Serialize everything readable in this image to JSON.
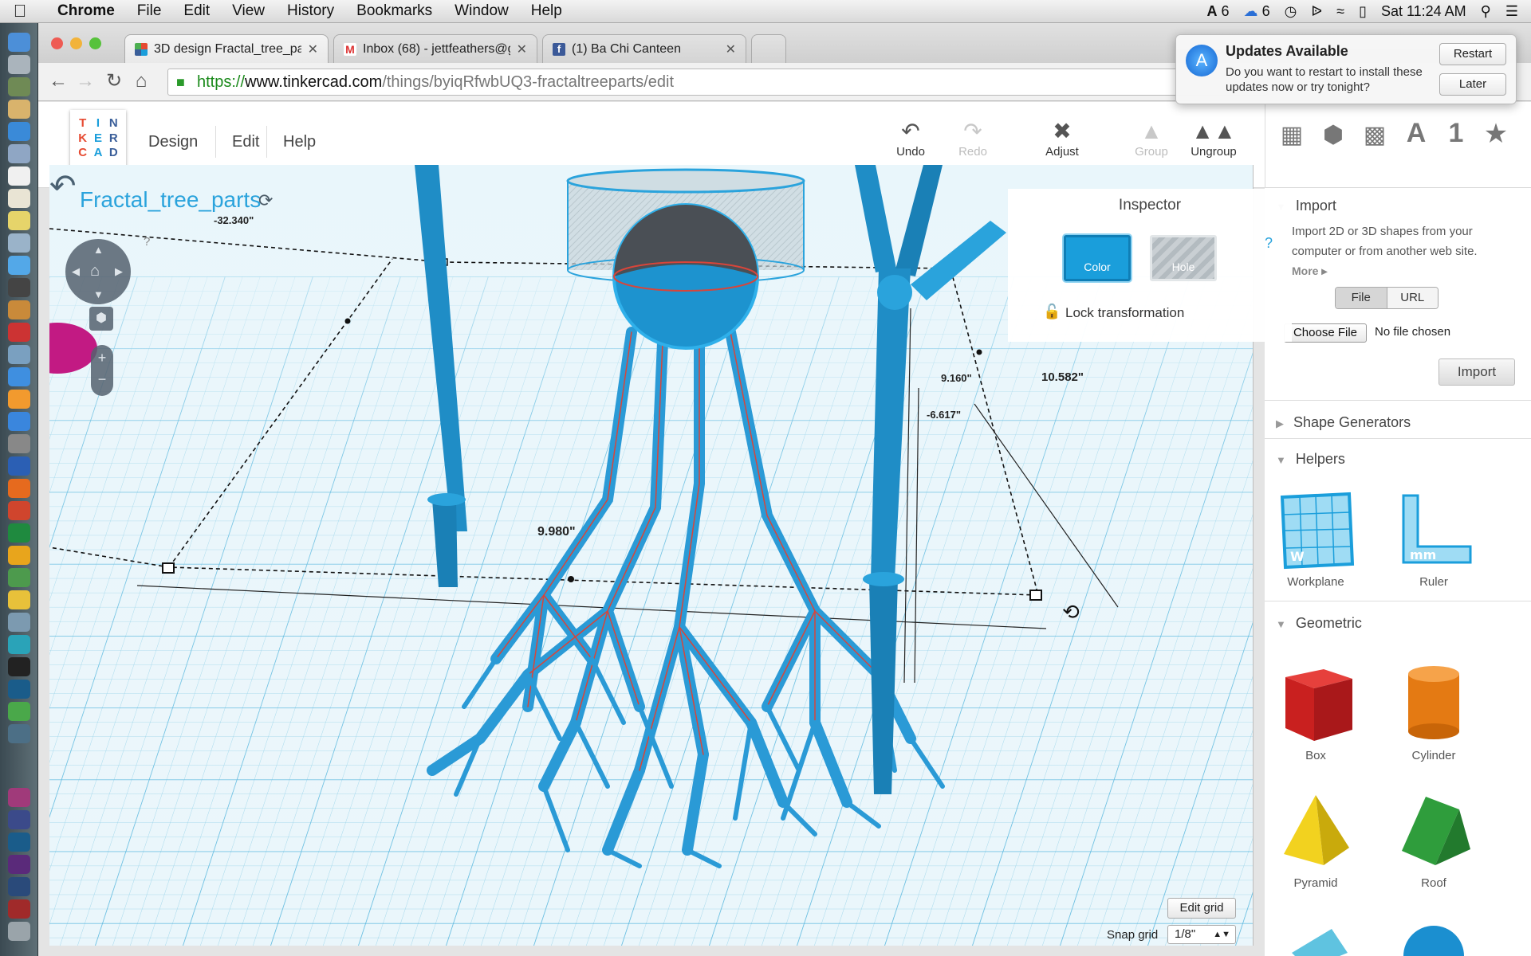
{
  "menubar": {
    "app": "Chrome",
    "items": [
      "File",
      "Edit",
      "View",
      "History",
      "Bookmarks",
      "Window",
      "Help"
    ],
    "status": {
      "adobe_count": "6",
      "cloud_count": "6",
      "clock": "Sat 11:24 AM"
    }
  },
  "tabs": [
    {
      "title": "3D design Fractal_tree_par",
      "icon": "tinkercad-icon"
    },
    {
      "title": "Inbox (68) - jettfeathers@g",
      "icon": "gmail-icon"
    },
    {
      "title": "(1) Ba Chi Canteen",
      "icon": "facebook-icon"
    }
  ],
  "url": {
    "scheme": "https://",
    "host": "www.tinkercad.com",
    "path": "/things/byiqRfwbUQ3-fractaltreeparts/edit"
  },
  "notification": {
    "title": "Updates Available",
    "body": "Do you want to restart to install these updates now or try tonight?",
    "restart": "Restart",
    "later": "Later"
  },
  "header": {
    "logo_letters": [
      "T",
      "I",
      "N",
      "K",
      "E",
      "R",
      "C",
      "A",
      "D"
    ],
    "menu": [
      "Design",
      "Edit",
      "Help"
    ],
    "tools": {
      "undo": "Undo",
      "redo": "Redo",
      "adjust": "Adjust",
      "group": "Group",
      "ungroup": "Ungroup"
    },
    "top_icons": [
      "workplane-icon",
      "box-icon",
      "cube-grid-icon",
      "text-icon",
      "number-icon",
      "favorites-icon"
    ]
  },
  "workplane": {
    "title": "Fractal_tree_parts",
    "dimensions": {
      "d1": "-32.340\"",
      "d2": "9.160\"",
      "d3": "-6.617\"",
      "d4": "10.582\"",
      "d5": "9.980\""
    },
    "help": "?",
    "edit_grid": "Edit grid",
    "snap_label": "Snap grid",
    "snap_value": "1/8\""
  },
  "inspector": {
    "title": "Inspector",
    "color_label": "Color",
    "hole_label": "Hole",
    "help": "?",
    "lock_label": "Lock transformation",
    "color_hex": "#1a9edb"
  },
  "panel": {
    "import": {
      "title": "Import",
      "description": "Import 2D or 3D shapes from your computer or from another web site.",
      "more": "More",
      "file_tab": "File",
      "url_tab": "URL",
      "choose_file": "Choose File",
      "no_file": "No file chosen",
      "import_button": "Import"
    },
    "shape_generators": "Shape Generators",
    "helpers": {
      "title": "Helpers",
      "items": [
        "Workplane",
        "Ruler"
      ]
    },
    "geometric": {
      "title": "Geometric",
      "items": [
        "Box",
        "Cylinder",
        "Pyramid",
        "Roof"
      ]
    }
  }
}
